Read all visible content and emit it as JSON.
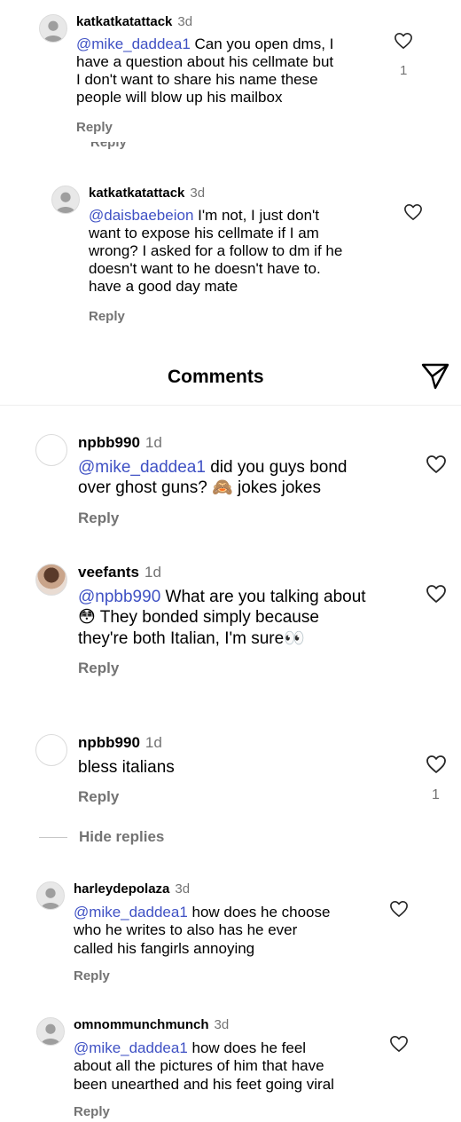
{
  "header": {
    "title": "Comments",
    "send_icon": "send-paper-plane-icon"
  },
  "labels": {
    "reply": "Reply",
    "hide_replies": "Hide replies"
  },
  "comments": [
    {
      "username": "katkatkatattack",
      "time": "3d",
      "mention": "@mike_daddea1",
      "lines": [
        " Can you open dms, I",
        "have a question about his cellmate but",
        "I don't want to share his name these",
        "people will blow up his mailbox"
      ],
      "likes": "1"
    },
    {
      "username": "katkatkatattack",
      "time": "3d",
      "mention": "@daisbaebeion",
      "lines": [
        " I'm not, I just don't",
        "want to expose his cellmate if I am",
        "wrong? I asked for a follow to dm if he",
        "doesn't want to he doesn't have to.",
        "have a good day mate"
      ]
    },
    {
      "username": "npbb990",
      "time": "1d",
      "mention": "@mike_daddea1",
      "lines": [
        " did you guys bond",
        "over ghost guns? ",
        " jokes jokes"
      ],
      "emoji": "🙈"
    },
    {
      "username": "veefants",
      "time": "1d",
      "mention": "@npbb990",
      "lines": [
        " What are you talking about",
        " They bonded simply because",
        "they're both Italian, I'm sure"
      ],
      "emoji_start": "😳",
      "emoji_end": "👀"
    },
    {
      "username": "npbb990",
      "time": "1d",
      "lines": [
        "bless italians"
      ],
      "likes": "1"
    },
    {
      "username": "harleydepolaza",
      "time": "3d",
      "mention": "@mike_daddea1",
      "lines": [
        " how does he choose",
        "who he writes to also has he ever",
        "called his fangirls annoying"
      ]
    },
    {
      "username": "omnommunchmunch",
      "time": "3d",
      "mention": "@mike_daddea1",
      "lines": [
        " how does he feel",
        "about all the pictures of him that have",
        "been unearthed and his feet going viral"
      ]
    }
  ]
}
